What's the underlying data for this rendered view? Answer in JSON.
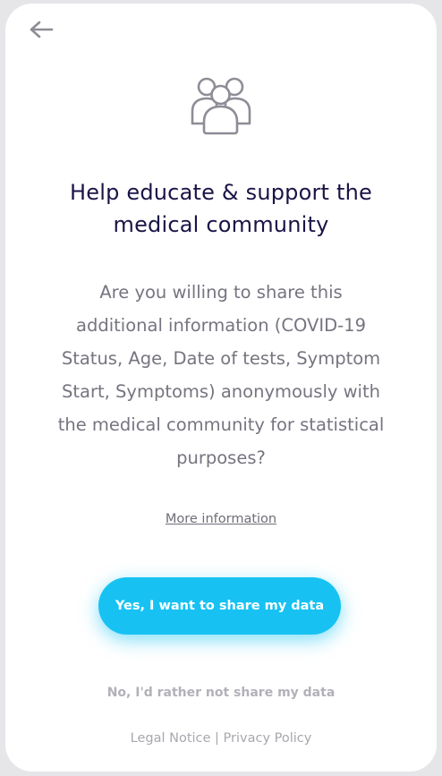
{
  "header": {
    "back_icon": "arrow-left-icon"
  },
  "hero": {
    "icon": "group-users-icon"
  },
  "title": {
    "line1": "Help educate & support the",
    "line2": "medical community"
  },
  "body": {
    "lines": [
      "Are you willing to share this",
      "additional information (COVID-19",
      "Status, Age, Date of tests, Symptom",
      "Start, Symptoms) anonymously with",
      "the medical community for statistical",
      "purposes?"
    ]
  },
  "more_info_label": "More information",
  "actions": {
    "accept_label": "Yes, I want to share my data",
    "decline_label": "No, I'd rather not share my data"
  },
  "footer": {
    "legal_label": "Legal Notice",
    "separator": "|",
    "privacy_label": "Privacy Policy"
  },
  "colors": {
    "accent": "#17c2f3",
    "title": "#1a1446",
    "body": "#77747f",
    "muted": "#b3b1b8"
  }
}
